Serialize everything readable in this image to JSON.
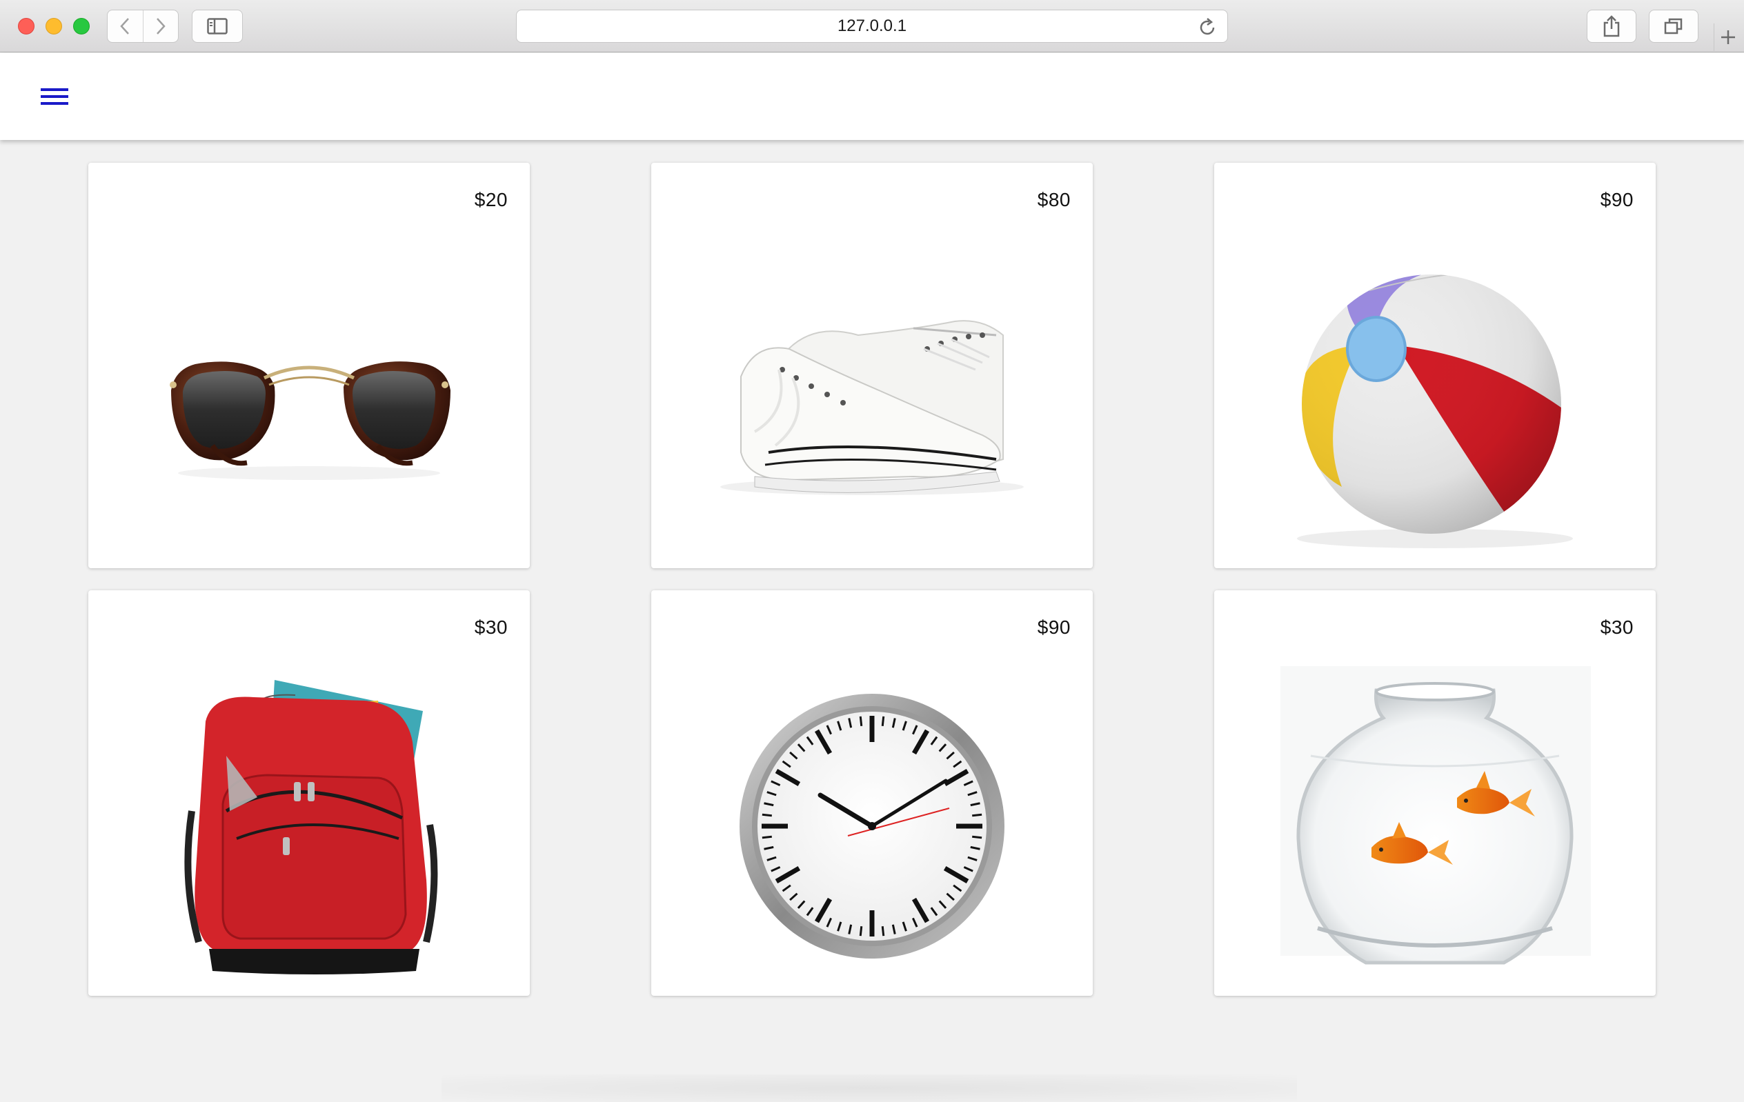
{
  "browser": {
    "url": "127.0.0.1"
  },
  "appbar": {
    "menu_icon": "hamburger-menu-icon",
    "accent_color": "#1a1ac8"
  },
  "products": [
    {
      "name": "sunglasses",
      "price": "$20"
    },
    {
      "name": "sneakers",
      "price": "$80"
    },
    {
      "name": "beach-ball",
      "price": "$90"
    },
    {
      "name": "backpack",
      "price": "$30"
    },
    {
      "name": "wall-clock",
      "price": "$90"
    },
    {
      "name": "fishbowl",
      "price": "$30"
    }
  ]
}
